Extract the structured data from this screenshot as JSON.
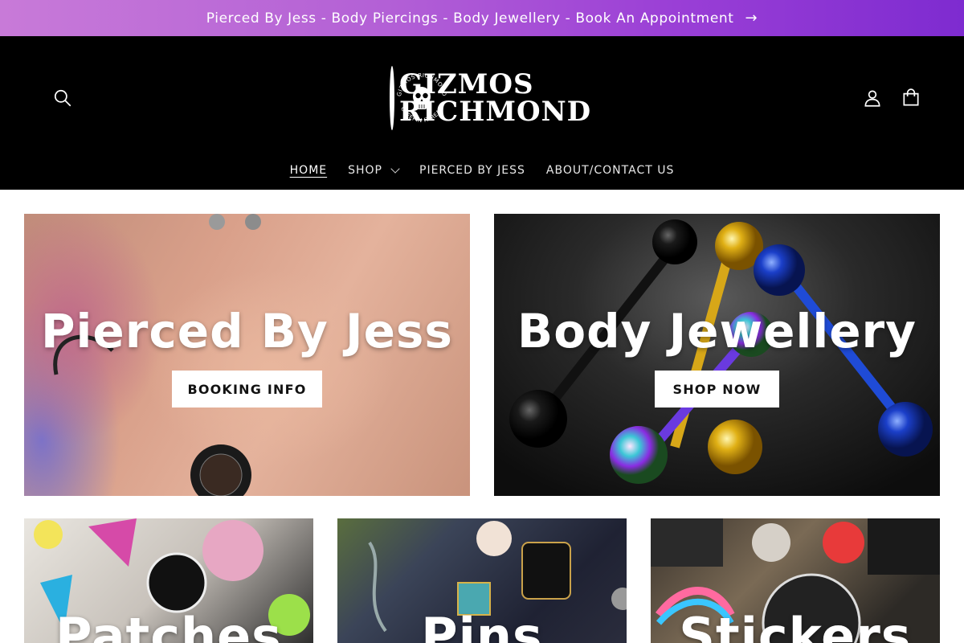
{
  "announcement": {
    "text": "Pierced By Jess - Body Piercings - Body Jewellery - Book An Appointment",
    "arrow": "→"
  },
  "header": {
    "logo": {
      "line1": "GIZMOS",
      "line2": "RICHMOND",
      "badge_top": "GIZMOS RICHMOND",
      "badge_bottom": "CREEPIN IT REAL"
    },
    "icons": [
      "search-icon",
      "account-icon",
      "cart-icon"
    ]
  },
  "nav": {
    "items": [
      {
        "label": "HOME",
        "active": true
      },
      {
        "label": "SHOP",
        "dropdown": true
      },
      {
        "label": "PIERCED BY JESS"
      },
      {
        "label": "ABOUT/CONTACT US"
      }
    ]
  },
  "hero": [
    {
      "title": "Pierced By Jess",
      "button": "BOOKING INFO"
    },
    {
      "title": "Body Jewellery",
      "button": "SHOP NOW"
    }
  ],
  "collections": [
    {
      "title": "Patches"
    },
    {
      "title": "Pins"
    },
    {
      "title": "Stickers"
    }
  ],
  "colors": {
    "announcement_start": "#c87ad8",
    "announcement_end": "#7e2bd0",
    "header_bg": "#000000",
    "button_bg": "#ffffff"
  }
}
